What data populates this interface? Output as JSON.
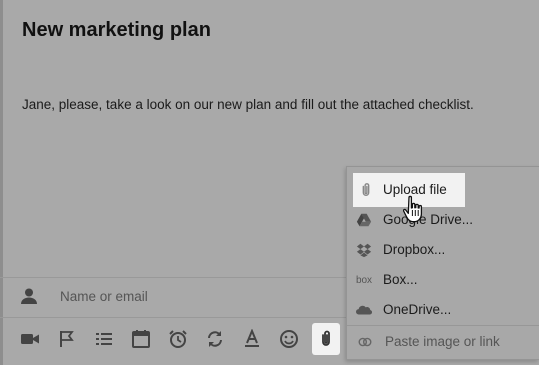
{
  "message": {
    "title": "New marketing plan",
    "body": "Jane, please, take a look on our new plan and fill out the attached checklist."
  },
  "recipient": {
    "placeholder": "Name or email",
    "icon": "person-icon"
  },
  "toolbar": {
    "buttons": [
      "video-icon",
      "flag-icon",
      "checklist-icon",
      "calendar-icon",
      "alarm-icon",
      "repeat-icon",
      "text-format-icon",
      "emoji-icon",
      "attach-icon"
    ],
    "active": "attach-icon"
  },
  "attach_menu": {
    "items": [
      {
        "label": "Upload file",
        "icon": "paperclip-icon"
      },
      {
        "label": "Google Drive...",
        "icon": "google-drive-icon"
      },
      {
        "label": "Dropbox...",
        "icon": "dropbox-icon"
      },
      {
        "label": "Box...",
        "icon": "box-icon"
      },
      {
        "label": "OneDrive...",
        "icon": "onedrive-icon"
      }
    ],
    "box_logo_text": "box",
    "paste": {
      "label": "Paste image or link",
      "icon": "link-icon"
    },
    "hovered": "Upload file"
  }
}
